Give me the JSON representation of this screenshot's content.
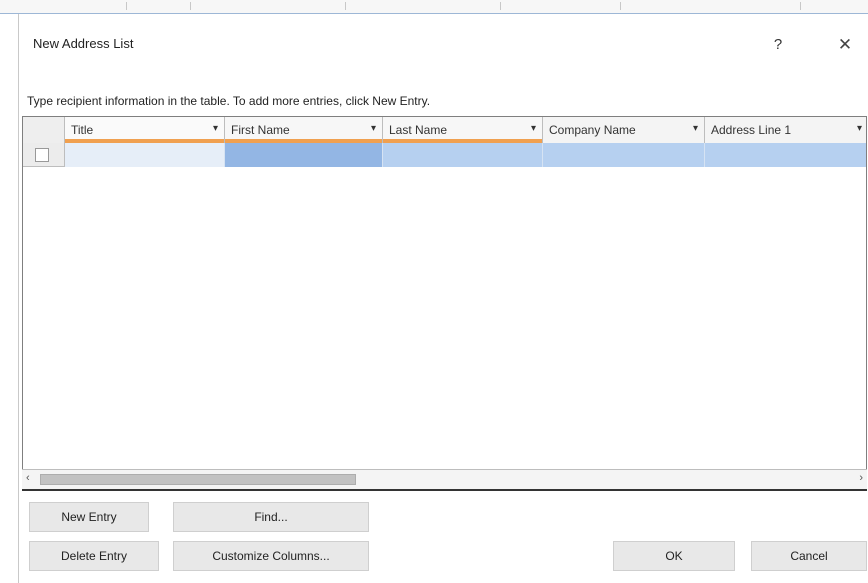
{
  "dialog": {
    "title": "New Address List",
    "help_label": "?",
    "close_label": "✕"
  },
  "instructions": "Type recipient information in the table. To add more entries, click New Entry.",
  "table": {
    "columns": [
      {
        "label": "Title"
      },
      {
        "label": "First Name"
      },
      {
        "label": "Last Name"
      },
      {
        "label": "Company Name"
      },
      {
        "label": "Address Line 1"
      }
    ],
    "dropdown_icon": "▾"
  },
  "scrollbar": {
    "left_icon": "‹",
    "right_icon": "›"
  },
  "buttons": {
    "new_entry": "New Entry",
    "find": "Find...",
    "delete_entry": "Delete Entry",
    "customize_columns": "Customize Columns...",
    "ok": "OK",
    "cancel": "Cancel"
  },
  "colors": {
    "header_accent": "#f0a050",
    "selected_cell": "#93b6e4",
    "row_highlight": "#b6d0f0"
  }
}
